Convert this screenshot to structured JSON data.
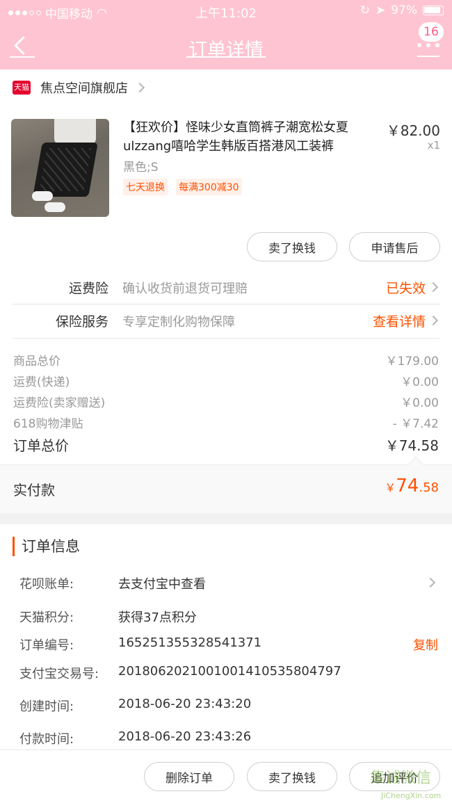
{
  "status_bar": {
    "carrier": "中国移动",
    "time": "上午11:02",
    "battery": "97%"
  },
  "nav": {
    "title": "订单详情",
    "badge": "16"
  },
  "shop": {
    "platform_icon": "天猫",
    "name": "焦点空间旗舰店"
  },
  "product": {
    "title": "【狂欢价】怪味少女直筒裤子潮宽松女夏ulzzang嘻哈学生韩版百搭港风工装裤",
    "sku": "黑色;S",
    "tags": [
      "七天退换",
      "每满300减30"
    ],
    "price": "￥82.00",
    "qty": "x1",
    "buttons": {
      "sell": "卖了换钱",
      "after_sale": "申请售后"
    }
  },
  "services": [
    {
      "label": "运费险",
      "desc": "确认收货前退货可理赔",
      "value": "已失效"
    },
    {
      "label": "保险服务",
      "desc": "专享定制化购物保障",
      "value": "查看详情"
    }
  ],
  "fees": [
    {
      "label": "商品总价",
      "value": "￥179.00"
    },
    {
      "label": "运费(快递)",
      "value": "￥0.00"
    },
    {
      "label": "运费险(卖家赠送)",
      "value": "￥0.00"
    },
    {
      "label": "618购物津贴",
      "value": "- ￥7.42"
    }
  ],
  "order_total": {
    "label": "订单总价",
    "value": "￥74.58"
  },
  "paid": {
    "label": "实付款",
    "currency": "￥",
    "integer": "74",
    "decimal": ".58"
  },
  "order_info": {
    "title": "订单信息",
    "rows": [
      {
        "key": "花呗账单:",
        "value": "去支付宝中查看"
      },
      {
        "key": "天猫积分:",
        "value": "获得37点积分"
      },
      {
        "key": "订单编号:",
        "value": "165251355328541371",
        "action": "复制"
      },
      {
        "key": "支付宝交易号:",
        "value": "2018062021001001410535804797"
      },
      {
        "key": "创建时间:",
        "value": "2018-06-20 23:43:20"
      },
      {
        "key": "付款时间:",
        "value": "2018-06-20 23:43:26"
      }
    ]
  },
  "bottom_buttons": [
    "删除订单",
    "卖了换钱",
    "追加评价"
  ],
  "watermark": {
    "text": "集诚微信",
    "url": "JiChengXin.com"
  },
  "colors": {
    "nav_bg": "#ffc4d2",
    "accent": "#ff5000",
    "tmall_red": "#e6002d"
  }
}
